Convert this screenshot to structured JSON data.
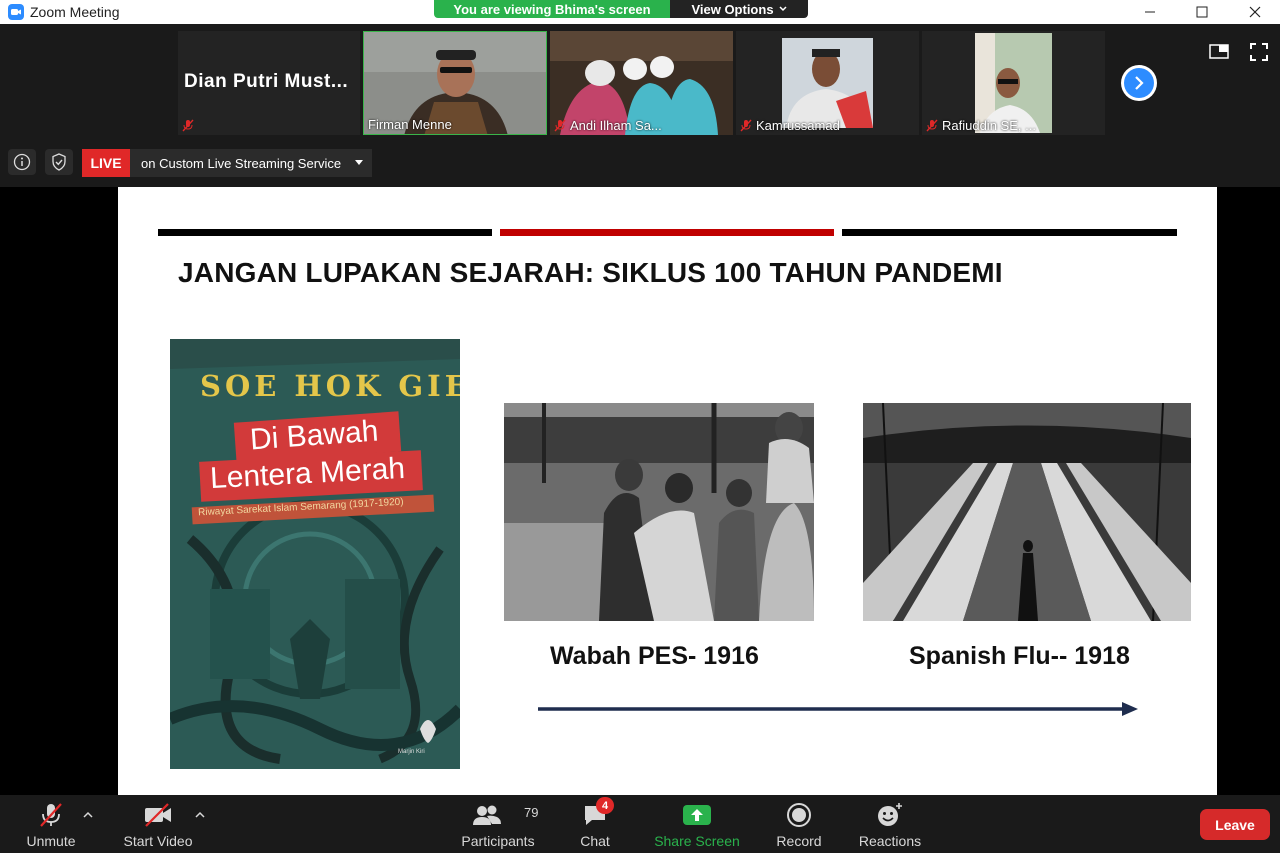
{
  "window": {
    "title": "Zoom Meeting",
    "viewing_banner": "You are viewing Bhima's screen",
    "view_options_label": "View Options"
  },
  "participants_strip": [
    {
      "name": "Dian Putri Must...",
      "muted": true,
      "video": false
    },
    {
      "name": "Firman Menne",
      "muted": false,
      "video": true,
      "active_speaker": true
    },
    {
      "name": "Andi Ilham Sa...",
      "muted": true,
      "video": true
    },
    {
      "name": "Kamrussamad",
      "muted": true,
      "video": true
    },
    {
      "name": "Rafiuddin SE, ...",
      "muted": true,
      "video": true
    }
  ],
  "live": {
    "badge": "LIVE",
    "service": "on Custom Live Streaming Service"
  },
  "slide": {
    "title": "JANGAN LUPAKAN SEJARAH: SIKLUS 100 TAHUN PANDEMI",
    "bar_colors": [
      "#000000",
      "#c00000",
      "#000000"
    ],
    "book": {
      "author": "SOE HOK GIE",
      "title_line1": "Di Bawah",
      "title_line2": "Lentera Merah",
      "subtitle": "Riwayat Sarekat Islam Semarang (1917-1920)",
      "publisher": "Marjin Kiri"
    },
    "captions": [
      "Wabah PES- 1916",
      "Spanish Flu-- 1918"
    ],
    "arrow_color": "#1f2d4e"
  },
  "toolbar": {
    "unmute": "Unmute",
    "start_video": "Start Video",
    "participants": "Participants",
    "participants_count": "79",
    "chat": "Chat",
    "chat_badge": "4",
    "share_screen": "Share Screen",
    "record": "Record",
    "reactions": "Reactions",
    "leave": "Leave"
  },
  "colors": {
    "accent_blue": "#2d8cff",
    "share_green": "#2ab24c",
    "live_red": "#e02828"
  }
}
